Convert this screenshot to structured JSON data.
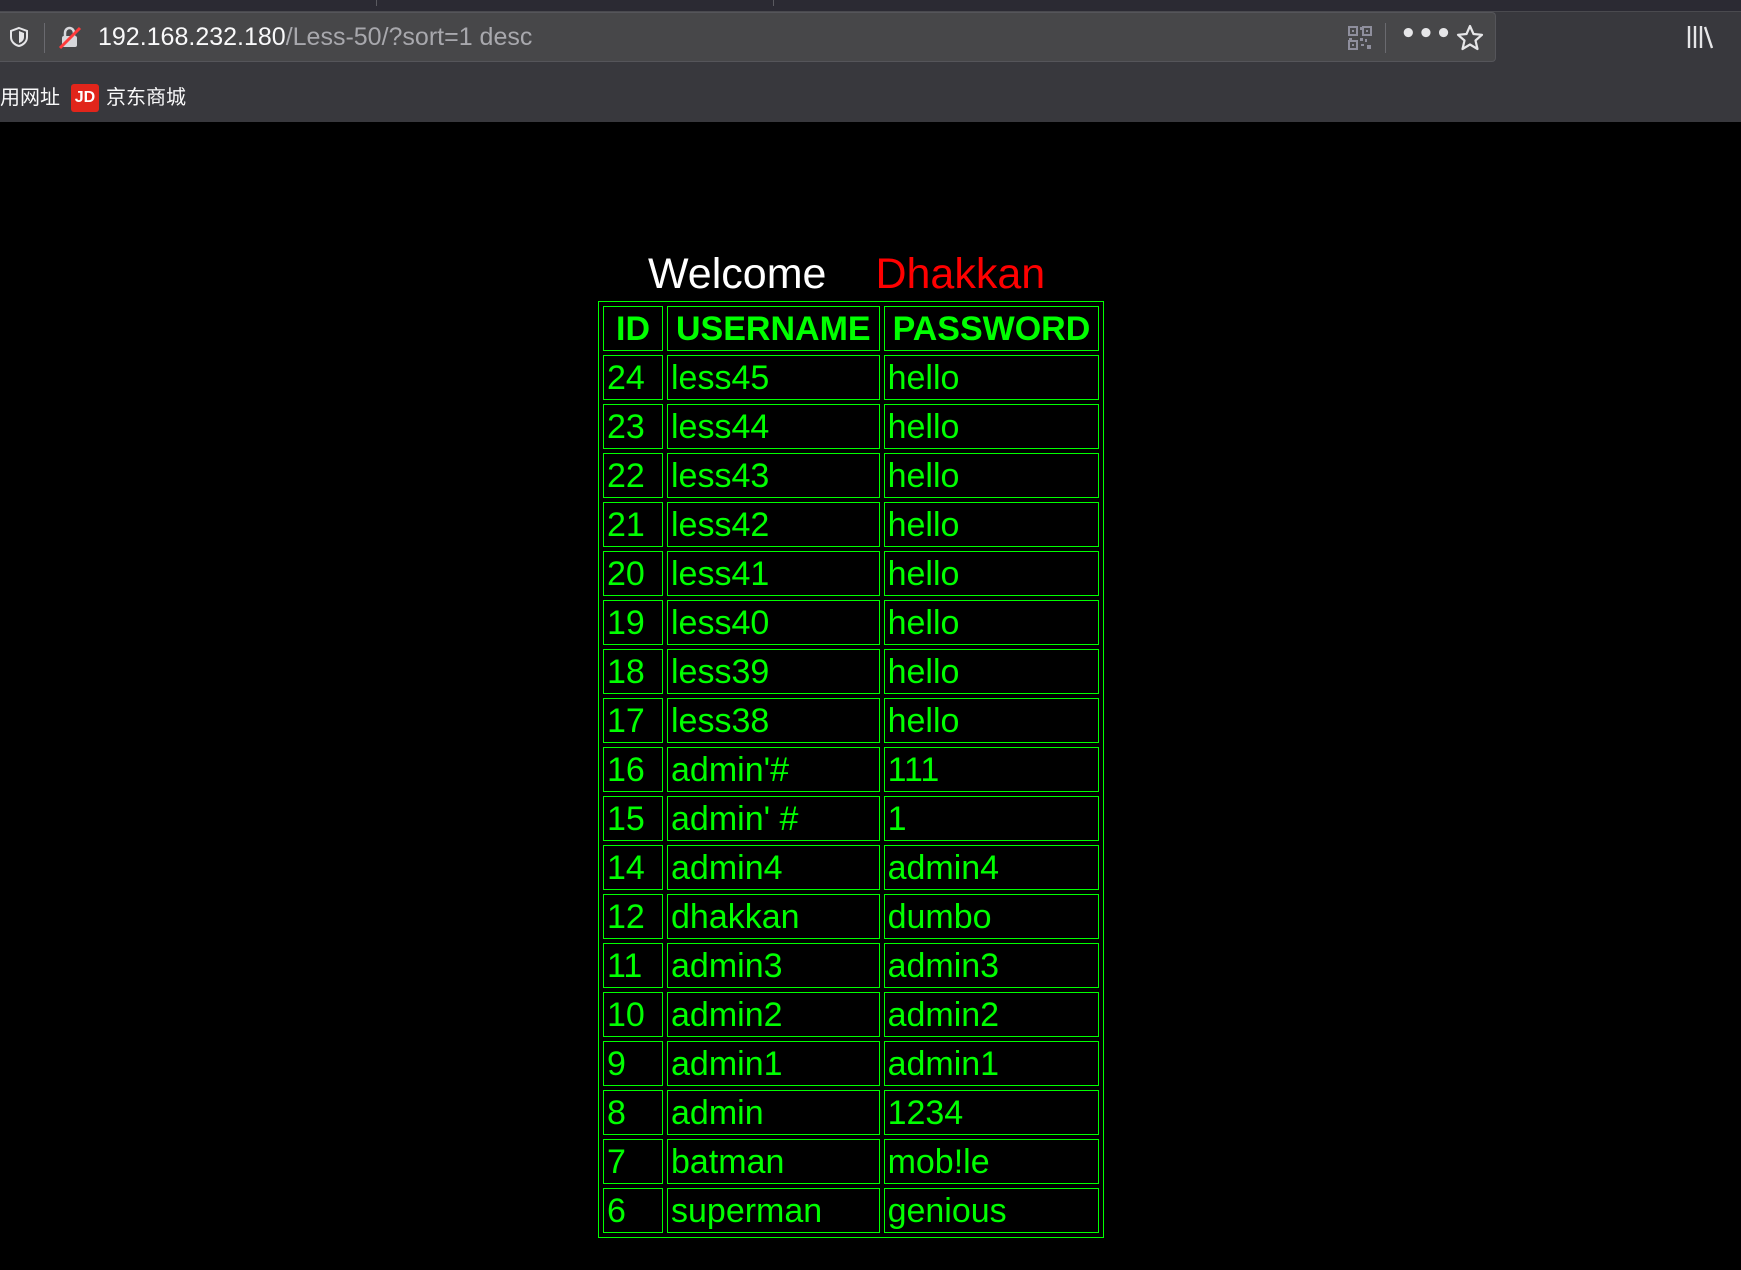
{
  "browser": {
    "url_host": "192.168.232.180",
    "url_path": "/Less-50/?sort=1 desc",
    "more_label": "•••",
    "bookmarks": [
      {
        "label": "用网址"
      },
      {
        "icon_text": "JD",
        "label": "京东商城"
      }
    ]
  },
  "page": {
    "welcome_text": "Welcome",
    "user_name": "Dhakkan",
    "colors": {
      "background": "#000000",
      "welcome": "#ffffff",
      "user_name": "#ff0000",
      "table": "#00ff00"
    },
    "table": {
      "headers": [
        "ID",
        "USERNAME",
        "PASSWORD"
      ],
      "rows": [
        [
          "24",
          "less45",
          "hello"
        ],
        [
          "23",
          "less44",
          "hello"
        ],
        [
          "22",
          "less43",
          "hello"
        ],
        [
          "21",
          "less42",
          "hello"
        ],
        [
          "20",
          "less41",
          "hello"
        ],
        [
          "19",
          "less40",
          "hello"
        ],
        [
          "18",
          "less39",
          "hello"
        ],
        [
          "17",
          "less38",
          "hello"
        ],
        [
          "16",
          "admin'#",
          "111"
        ],
        [
          "15",
          "admin' #",
          "1"
        ],
        [
          "14",
          "admin4",
          "admin4"
        ],
        [
          "12",
          "dhakkan",
          "dumbo"
        ],
        [
          "11",
          "admin3",
          "admin3"
        ],
        [
          "10",
          "admin2",
          "admin2"
        ],
        [
          "9",
          "admin1",
          "admin1"
        ],
        [
          "8",
          "admin",
          "1234"
        ],
        [
          "7",
          "batman",
          "mob!le"
        ],
        [
          "6",
          "superman",
          "genious"
        ]
      ]
    }
  }
}
